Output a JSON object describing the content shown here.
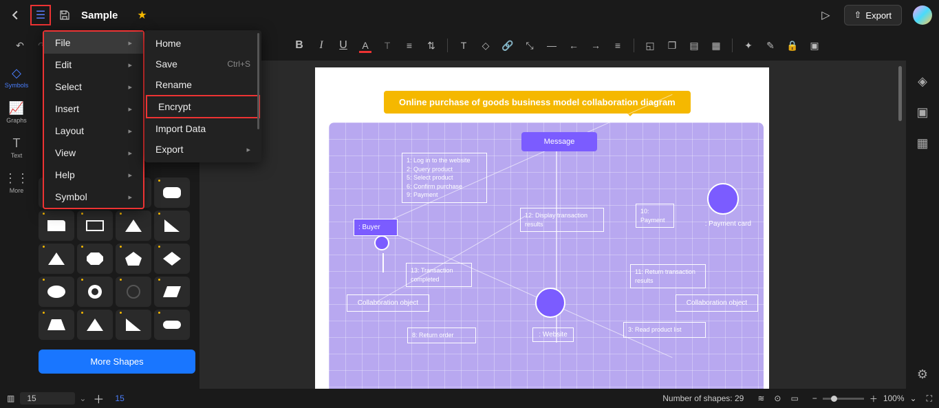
{
  "header": {
    "doc_title": "Sample",
    "export_label": "Export"
  },
  "main_menu": {
    "items": [
      {
        "label": "File",
        "has_sub": true,
        "hl": true
      },
      {
        "label": "Edit",
        "has_sub": true
      },
      {
        "label": "Select",
        "has_sub": true
      },
      {
        "label": "Insert",
        "has_sub": true
      },
      {
        "label": "Layout",
        "has_sub": true
      },
      {
        "label": "View",
        "has_sub": true
      },
      {
        "label": "Help",
        "has_sub": true
      },
      {
        "label": "Symbol",
        "has_sub": true
      }
    ]
  },
  "file_submenu": {
    "items": [
      {
        "label": "Home",
        "shortcut": "",
        "has_sub": false
      },
      {
        "label": "Save",
        "shortcut": "Ctrl+S",
        "has_sub": false
      },
      {
        "label": "Rename",
        "shortcut": "",
        "has_sub": false
      },
      {
        "label": "Encrypt",
        "shortcut": "",
        "has_sub": false,
        "boxed": true
      },
      {
        "label": "Import Data",
        "shortcut": "",
        "has_sub": false
      },
      {
        "label": "Export",
        "shortcut": "",
        "has_sub": true
      }
    ]
  },
  "left_rail": {
    "items": [
      {
        "label": "Symbols",
        "active": true
      },
      {
        "label": "Graphs"
      },
      {
        "label": "Text"
      },
      {
        "label": "More"
      }
    ]
  },
  "shapes": {
    "more_label": "More Shapes"
  },
  "diagram": {
    "title": "Online purchase of goods business model collaboration diagram",
    "message": "Message",
    "buyer": ": Buyer",
    "payment_card": ": Payment card",
    "collab_left": "Collaboration object",
    "collab_right": "Collaboration object",
    "website": ": Website",
    "note1": "1: Log in to the website\n2: Query product\n5: Select product\n6: Confirm purchase\n9: Payment",
    "note12": "12: Display transaction results",
    "note10": "10: Payment",
    "note13": "13: Transaction completed",
    "note11": "11: Return transaction results",
    "note8": "8: Return order",
    "note3": "3: Read product list"
  },
  "statusbar": {
    "zoom_input": "15",
    "page_num": "15",
    "shape_count_label": "Number of shapes: 29",
    "zoom_pct": "100%"
  }
}
